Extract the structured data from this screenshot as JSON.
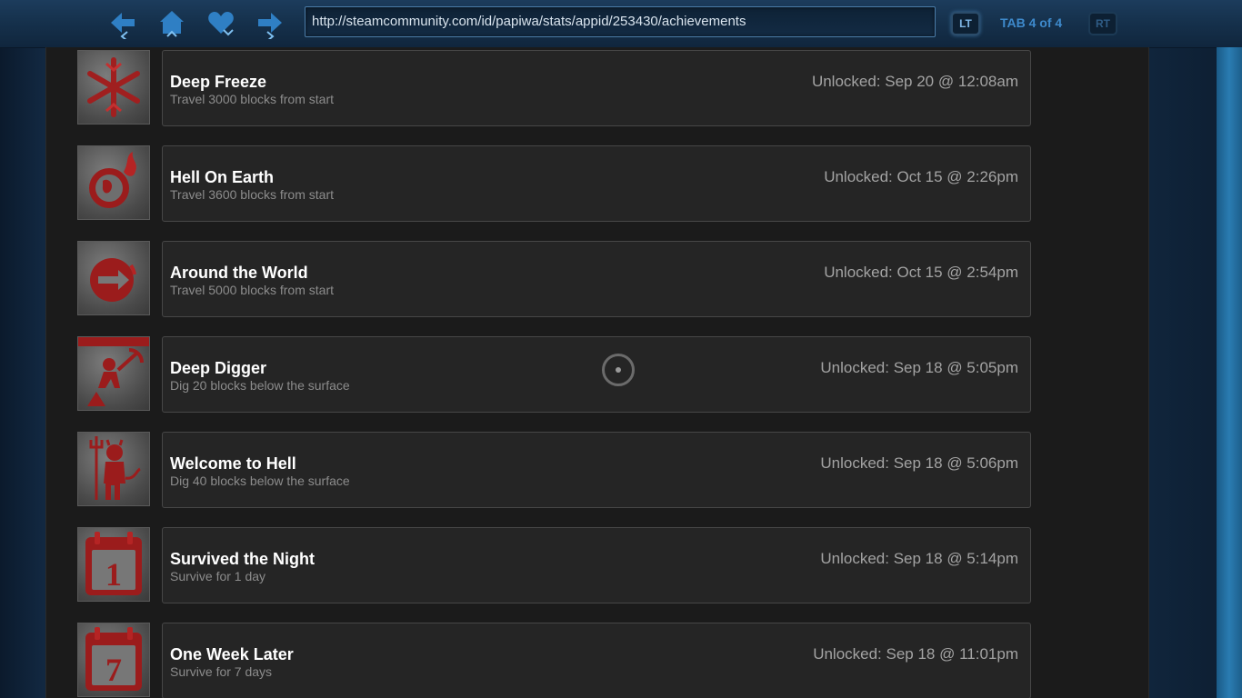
{
  "browser": {
    "url": "http://steamcommunity.com/id/papiwa/stats/appid/253430/achievements",
    "tab_indicator": "TAB 4 of 4",
    "left_trigger": "LT",
    "right_trigger": "RT",
    "nav_icons": [
      "back-icon",
      "home-icon",
      "favorites-icon",
      "forward-icon"
    ]
  },
  "colors": {
    "accent": "#3e8acc",
    "icon_red": "#9b1c1c",
    "card_bg": "#252525",
    "panel_bg": "#1b1b1b"
  },
  "achievements": [
    {
      "icon": "snowflake-icon",
      "title": "Deep Freeze",
      "description": "Travel 3000 blocks from start",
      "unlocked": "Unlocked: Sep 20 @ 12:08am"
    },
    {
      "icon": "flaming-globe-icon",
      "title": "Hell On Earth",
      "description": "Travel 3600 blocks from start",
      "unlocked": "Unlocked: Oct 15 @ 2:26pm"
    },
    {
      "icon": "circle-arrow-icon",
      "title": "Around the World",
      "description": "Travel 5000 blocks from start",
      "unlocked": "Unlocked: Oct 15 @ 2:54pm"
    },
    {
      "icon": "digger-icon",
      "title": "Deep Digger",
      "description": "Dig 20 blocks below the surface",
      "unlocked": "Unlocked: Sep 18 @ 5:05pm"
    },
    {
      "icon": "devil-icon",
      "title": "Welcome to Hell",
      "description": "Dig 40 blocks below the surface",
      "unlocked": "Unlocked: Sep 18 @ 5:06pm"
    },
    {
      "icon": "calendar-1-icon",
      "title": "Survived the Night",
      "description": "Survive for 1 day",
      "unlocked": "Unlocked: Sep 18 @ 5:14pm",
      "calendar_number": "1"
    },
    {
      "icon": "calendar-7-icon",
      "title": "One Week Later",
      "description": "Survive for 7 days",
      "unlocked": "Unlocked: Sep 18 @ 11:01pm",
      "calendar_number": "7"
    }
  ]
}
